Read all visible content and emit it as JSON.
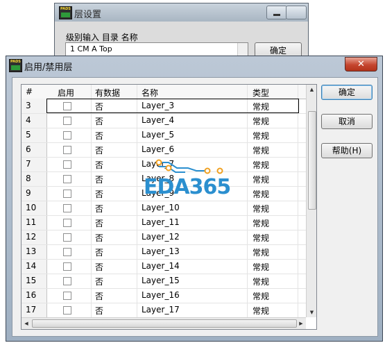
{
  "bg_window": {
    "title": "层设置",
    "header": "级别输入 目录 名称",
    "list_row": "1   CM   A    Top",
    "ok_label": "确定"
  },
  "dialog": {
    "title": "启用/禁用层",
    "close_glyph": "✕",
    "columns": [
      "#",
      "启用",
      "有数据",
      "名称",
      "类型"
    ],
    "rows": [
      {
        "num": "3",
        "data": "否",
        "name": "Layer_3",
        "type": "常规",
        "enabled": false
      },
      {
        "num": "4",
        "data": "否",
        "name": "Layer_4",
        "type": "常规",
        "enabled": false
      },
      {
        "num": "5",
        "data": "否",
        "name": "Layer_5",
        "type": "常规",
        "enabled": false
      },
      {
        "num": "6",
        "data": "否",
        "name": "Layer_6",
        "type": "常规",
        "enabled": false
      },
      {
        "num": "7",
        "data": "否",
        "name": "Layer_7",
        "type": "常规",
        "enabled": false
      },
      {
        "num": "8",
        "data": "否",
        "name": "Layer_8",
        "type": "常规",
        "enabled": false
      },
      {
        "num": "9",
        "data": "否",
        "name": "Layer_9",
        "type": "常规",
        "enabled": false
      },
      {
        "num": "10",
        "data": "否",
        "name": "Layer_10",
        "type": "常规",
        "enabled": false
      },
      {
        "num": "11",
        "data": "否",
        "name": "Layer_11",
        "type": "常规",
        "enabled": false
      },
      {
        "num": "12",
        "data": "否",
        "name": "Layer_12",
        "type": "常规",
        "enabled": false
      },
      {
        "num": "13",
        "data": "否",
        "name": "Layer_13",
        "type": "常规",
        "enabled": false
      },
      {
        "num": "14",
        "data": "否",
        "name": "Layer_14",
        "type": "常规",
        "enabled": false
      },
      {
        "num": "15",
        "data": "否",
        "name": "Layer_15",
        "type": "常规",
        "enabled": false
      },
      {
        "num": "16",
        "data": "否",
        "name": "Layer_16",
        "type": "常规",
        "enabled": false
      },
      {
        "num": "17",
        "data": "否",
        "name": "Layer_17",
        "type": "常规",
        "enabled": false
      }
    ],
    "buttons": {
      "ok": "确定",
      "cancel": "取消",
      "help": "帮助(H)"
    }
  },
  "app_icon": {
    "line1": "PADS"
  },
  "watermark": {
    "text": "EDA365"
  },
  "colors": {
    "watermark_blue": "#2b8fcf",
    "watermark_orange": "#f0a020",
    "close_red": "#c5462f"
  }
}
